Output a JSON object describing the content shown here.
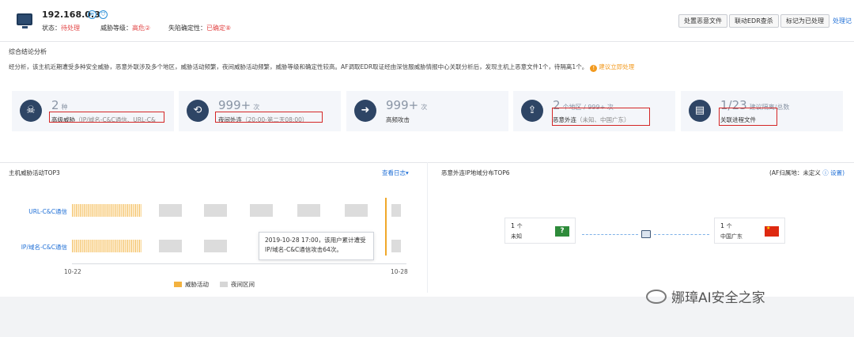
{
  "header": {
    "ip": "192.168.0.3",
    "status_label": "状态：",
    "status_value": "待处理",
    "threat_label": "威胁等级：",
    "threat_value": "高危②",
    "fallen_label": "失陷确定性：",
    "fallen_value": "已确定⑧",
    "buttons": [
      "处置恶意文件",
      "联动EDR查杀",
      "标记为已处理"
    ],
    "link": "处理记"
  },
  "summary": {
    "title": "综合结论分析",
    "text": "经分析，该主机近期遭受多种安全威胁，恶意外联涉及多个地区，威胁活动频繁，夜间威胁活动频繁，威胁等级和确定性较高。AF调取EDR取证经由深信服威胁情报中心关联分析后，发现主机上恶意文件1个，待隔离1个。",
    "action": "建议立即处理"
  },
  "cards": [
    {
      "icon": "threat-skull-icon",
      "value": "2",
      "unit": "种",
      "label": "高级威胁",
      "sub": "（IP/域名-C&C通信、URL-C&"
    },
    {
      "icon": "night-connect-icon",
      "value": "999+",
      "unit": "次",
      "label": "夜间外连",
      "sub": "（20:00-第二天08:00）"
    },
    {
      "icon": "high-freq-attack-icon",
      "value": "999+",
      "unit": "次",
      "label": "高频攻击",
      "sub": ""
    },
    {
      "icon": "malicious-outbound-icon",
      "value": "2",
      "unit": "个地区 / 999+ 次",
      "label": "恶意外连",
      "sub": "（未知、中国广东）"
    },
    {
      "icon": "related-process-icon",
      "value": "1/23",
      "unit": "建议隔离/总数",
      "label": "关联进程文件",
      "sub": ""
    }
  ],
  "activity": {
    "title": "主机威胁活动TOP3",
    "view_log": "查看日志▾",
    "rows": [
      "URL-C&C通信",
      "IP/域名-C&C通信"
    ],
    "x_start": "10-22",
    "x_end": "10-28",
    "legend": [
      "威胁活动",
      "夜间区间"
    ],
    "tooltip_line1": "2019-10-28 17:00，该用户累计遭受",
    "tooltip_line2": "IP/域名-C&C通信攻击64次。",
    "colors": {
      "threat": "#f3c26a",
      "night": "#dcdcdc"
    }
  },
  "geo": {
    "title": "恶意外连IP地域分布TOP6",
    "note": "(AF归属地：未定义",
    "note_link": "ⓘ 设置)",
    "nodes": [
      {
        "count": "1",
        "unit": "个",
        "name": "未知",
        "flag": "?"
      },
      {
        "count": "1",
        "unit": "个",
        "name": "中国广东",
        "flag": ""
      }
    ]
  },
  "footer": {
    "brand": "娜璋AI安全之家"
  }
}
